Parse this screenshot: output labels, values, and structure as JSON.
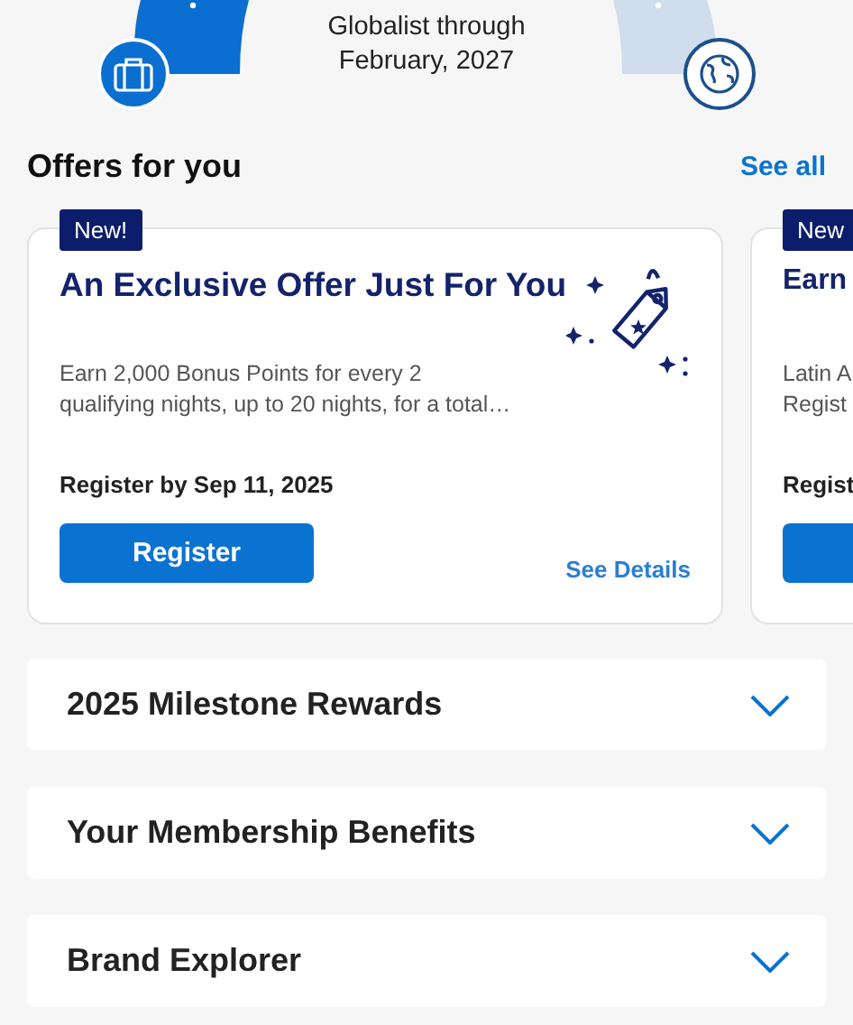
{
  "status_banner": {
    "lines": [
      "Globalist through",
      "February, 2027"
    ]
  },
  "offers": {
    "title": "Offers for you",
    "see_all": "See all",
    "cards": [
      {
        "badge": "New!",
        "title": "An Exclusive Offer Just For You",
        "description": [
          "Earn 2,000 Bonus Points for every 2",
          "qualifying nights, up to 20 nights, for a total…"
        ],
        "deadline": "Register by Sep 11, 2025",
        "button": "Register",
        "details_link": "See Details"
      },
      {
        "badge": "New",
        "title": "Earn",
        "description": [
          "Latin A",
          "Regist"
        ],
        "deadline": "Regist"
      }
    ]
  },
  "sections": [
    {
      "title": "2025 Milestone Rewards",
      "expanded": false
    },
    {
      "title": "Your Membership Benefits",
      "expanded": false
    },
    {
      "title": "Brand Explorer",
      "expanded": false
    }
  ]
}
